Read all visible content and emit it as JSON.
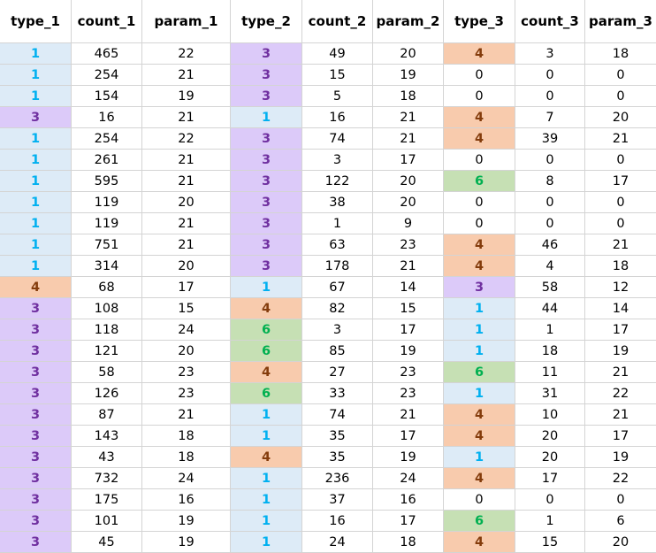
{
  "table": {
    "columns": [
      "type_1",
      "count_1",
      "param_1",
      "type_2",
      "count_2",
      "param_2",
      "type_3",
      "count_3",
      "param_3"
    ],
    "type_colors": {
      "1": {
        "fill": "#ddebf7",
        "text": "#00b0f0"
      },
      "3": {
        "fill": "#dccaf9",
        "text": "#7030a0"
      },
      "4": {
        "fill": "#f8cbad",
        "text": "#843c0c"
      },
      "6": {
        "fill": "#c6e0b4",
        "text": "#00b050"
      },
      "0": {
        "fill": "#ffffff",
        "text": "#000000"
      }
    },
    "rows": [
      [
        "1",
        "465",
        "22",
        "3",
        "49",
        "20",
        "4",
        "3",
        "18"
      ],
      [
        "1",
        "254",
        "21",
        "3",
        "15",
        "19",
        "0",
        "0",
        "0"
      ],
      [
        "1",
        "154",
        "19",
        "3",
        "5",
        "18",
        "0",
        "0",
        "0"
      ],
      [
        "3",
        "16",
        "21",
        "1",
        "16",
        "21",
        "4",
        "7",
        "20"
      ],
      [
        "1",
        "254",
        "22",
        "3",
        "74",
        "21",
        "4",
        "39",
        "21"
      ],
      [
        "1",
        "261",
        "21",
        "3",
        "3",
        "17",
        "0",
        "0",
        "0"
      ],
      [
        "1",
        "595",
        "21",
        "3",
        "122",
        "20",
        "6",
        "8",
        "17"
      ],
      [
        "1",
        "119",
        "20",
        "3",
        "38",
        "20",
        "0",
        "0",
        "0"
      ],
      [
        "1",
        "119",
        "21",
        "3",
        "1",
        "9",
        "0",
        "0",
        "0"
      ],
      [
        "1",
        "751",
        "21",
        "3",
        "63",
        "23",
        "4",
        "46",
        "21"
      ],
      [
        "1",
        "314",
        "20",
        "3",
        "178",
        "21",
        "4",
        "4",
        "18"
      ],
      [
        "4",
        "68",
        "17",
        "1",
        "67",
        "14",
        "3",
        "58",
        "12"
      ],
      [
        "3",
        "108",
        "15",
        "4",
        "82",
        "15",
        "1",
        "44",
        "14"
      ],
      [
        "3",
        "118",
        "24",
        "6",
        "3",
        "17",
        "1",
        "1",
        "17"
      ],
      [
        "3",
        "121",
        "20",
        "6",
        "85",
        "19",
        "1",
        "18",
        "19"
      ],
      [
        "3",
        "58",
        "23",
        "4",
        "27",
        "23",
        "6",
        "11",
        "21"
      ],
      [
        "3",
        "126",
        "23",
        "6",
        "33",
        "23",
        "1",
        "31",
        "22"
      ],
      [
        "3",
        "87",
        "21",
        "1",
        "74",
        "21",
        "4",
        "10",
        "21"
      ],
      [
        "3",
        "143",
        "18",
        "1",
        "35",
        "17",
        "4",
        "20",
        "17"
      ],
      [
        "3",
        "43",
        "18",
        "4",
        "35",
        "19",
        "1",
        "20",
        "19"
      ],
      [
        "3",
        "732",
        "24",
        "1",
        "236",
        "24",
        "4",
        "17",
        "22"
      ],
      [
        "3",
        "175",
        "16",
        "1",
        "37",
        "16",
        "0",
        "0",
        "0"
      ],
      [
        "3",
        "101",
        "19",
        "1",
        "16",
        "17",
        "6",
        "1",
        "6"
      ],
      [
        "3",
        "45",
        "19",
        "1",
        "24",
        "18",
        "4",
        "15",
        "20"
      ]
    ]
  }
}
